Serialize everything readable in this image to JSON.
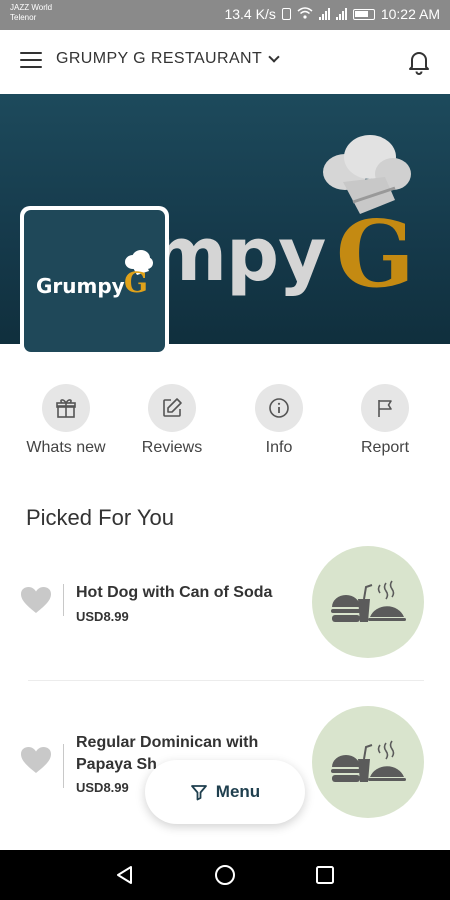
{
  "status_bar": {
    "carrier_1": "JAZZ World",
    "carrier_2": "Telenor",
    "speed": "13.4 K/s",
    "time": "10:22 AM"
  },
  "app_bar": {
    "title": "GRUMPY G RESTAURANT",
    "menu_icon": "hamburger-icon",
    "dropdown_icon": "chevron-down-icon",
    "notification_icon": "bell-icon"
  },
  "banner": {
    "brand_word": "mpy",
    "brand_letter": "G"
  },
  "logo": {
    "word": "Grumpy",
    "letter": "G"
  },
  "actions": [
    {
      "label": "Whats new",
      "icon": "gift-icon"
    },
    {
      "label": "Reviews",
      "icon": "edit-icon"
    },
    {
      "label": "Info",
      "icon": "info-icon"
    },
    {
      "label": "Report",
      "icon": "flag-icon"
    }
  ],
  "section": {
    "title": "Picked For You"
  },
  "items": [
    {
      "name": "Hot Dog with Can of Soda",
      "price": "USD8.99",
      "icon": "food-icon"
    },
    {
      "name": "Regular Dominican with Papaya Sh",
      "price": "USD8.99",
      "icon": "food-icon"
    }
  ],
  "fab": {
    "label": "Menu",
    "icon": "filter-icon"
  },
  "colors": {
    "banner": "#1d4a5c",
    "brand_gold": "#c48a12",
    "food_circle": "#d9e4cd",
    "menu_text": "#1f3f4e"
  }
}
